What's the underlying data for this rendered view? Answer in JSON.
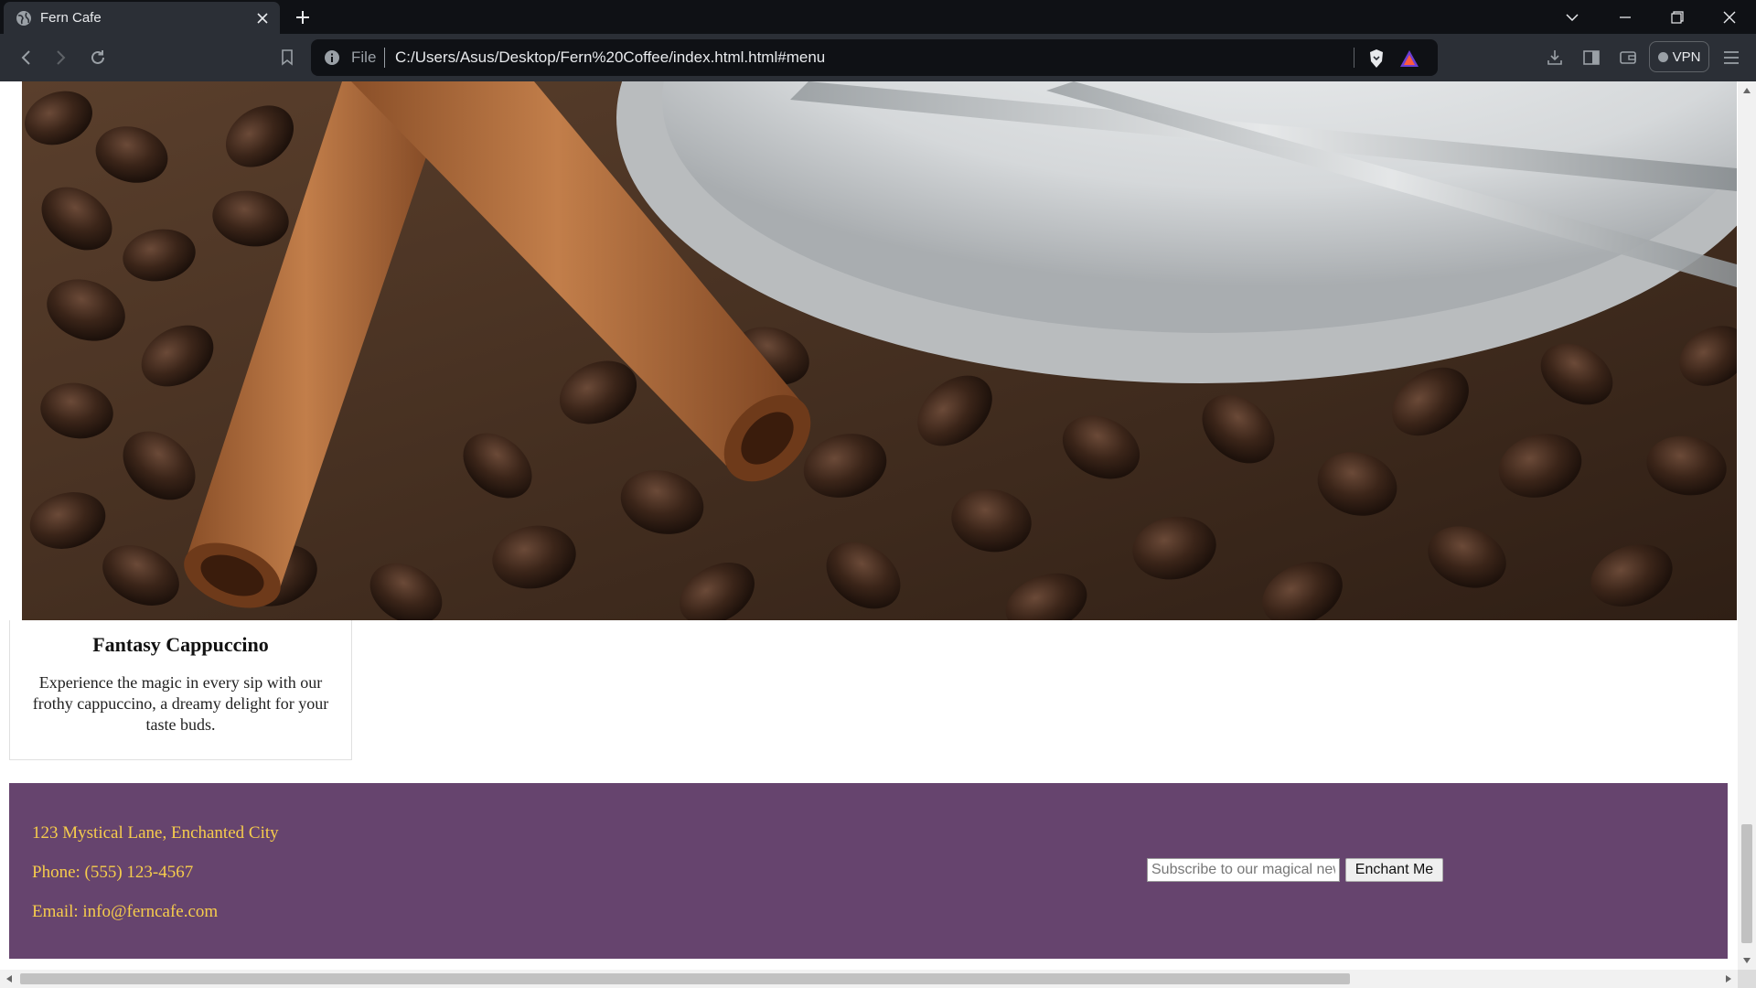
{
  "browser": {
    "tab_title": "Fern Cafe",
    "address_scheme": "File",
    "address_url": "C:/Users/Asus/Desktop/Fern%20Coffee/index.html.html#menu",
    "vpn_label": "VPN"
  },
  "menu_item": {
    "title": "Fantasy Cappuccino",
    "description": "Experience the magic in every sip with our frothy cappuccino, a dreamy delight for your taste buds."
  },
  "footer": {
    "address": "123 Mystical Lane, Enchanted City",
    "phone": "Phone: (555) 123-4567",
    "email": "Email: info@ferncafe.com",
    "subscribe_placeholder": "Subscribe to our magical newsletter",
    "subscribe_button": "Enchant Me"
  },
  "colors": {
    "footer_bg": "#66446e",
    "footer_text": "#f6cc4c",
    "chrome_dark": "#0f1115",
    "chrome_toolbar": "#2b2f36"
  }
}
